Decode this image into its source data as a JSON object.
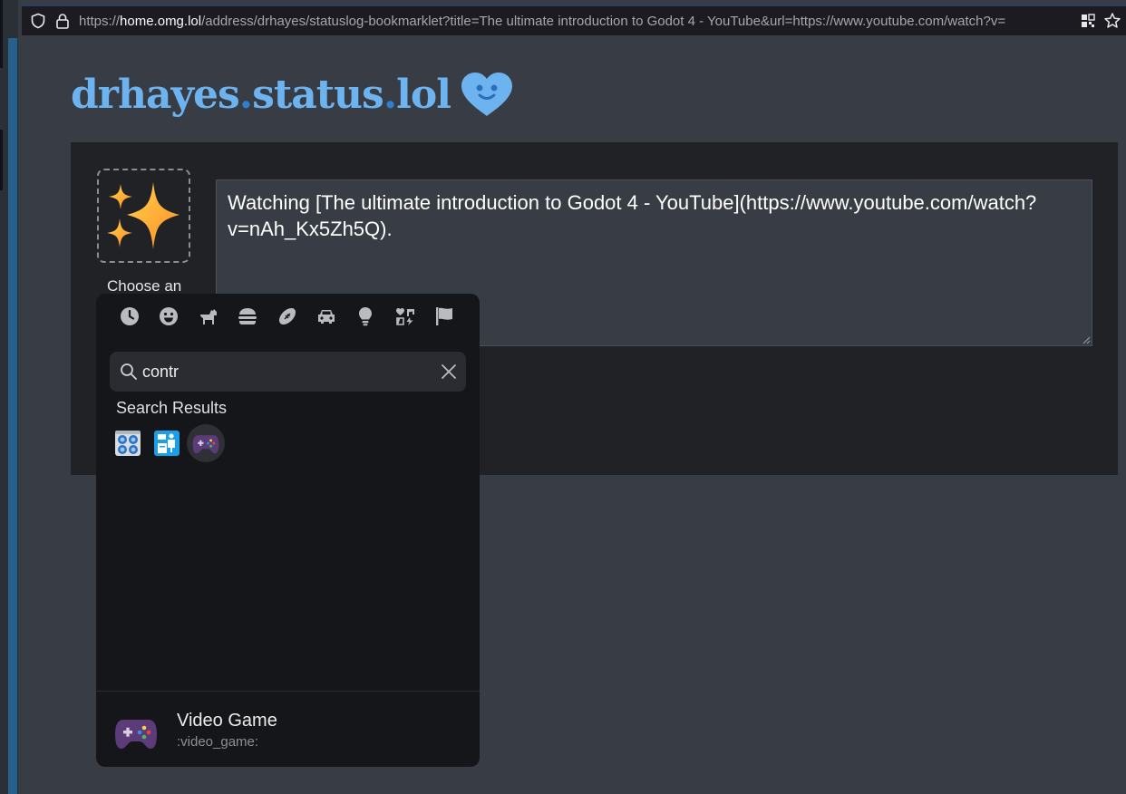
{
  "browser": {
    "url_prefix": "https://",
    "url_host": "home.omg.lol",
    "url_path": "/address/drhayes/statuslog-bookmarklet?title=The ultimate introduction to Godot 4 - YouTube&url=https://www.youtube.com/watch?v="
  },
  "logo": {
    "part1": "drhayes",
    "dot1": ".",
    "part2": "status",
    "dot2": ".",
    "part3": "lol"
  },
  "composer": {
    "status_text": "Watching [The ultimate introduction to Godot 4 - YouTube](https://www.youtube.com/watch?v=nAh_Kx5Zh5Q).",
    "choose_label": "Choose an",
    "selected_emoji_icon": "sparkles-icon"
  },
  "emoji_picker": {
    "categories": [
      {
        "name": "recent",
        "icon": "clock-icon"
      },
      {
        "name": "smileys",
        "icon": "smiley-icon"
      },
      {
        "name": "animals",
        "icon": "dog-icon"
      },
      {
        "name": "food",
        "icon": "burger-icon"
      },
      {
        "name": "activities",
        "icon": "football-icon"
      },
      {
        "name": "travel",
        "icon": "car-icon"
      },
      {
        "name": "objects",
        "icon": "lightbulb-icon"
      },
      {
        "name": "symbols",
        "icon": "symbols-icon"
      },
      {
        "name": "flags",
        "icon": "flag-icon"
      }
    ],
    "search_value": "contr",
    "results_title": "Search Results",
    "results": [
      {
        "icon": "control-knobs-icon"
      },
      {
        "icon": "passport-control-icon"
      },
      {
        "icon": "video-game-icon",
        "selected": true
      }
    ],
    "preview": {
      "icon": "video-game-icon",
      "name": "Video Game",
      "shortcode": ":video_game:"
    }
  },
  "colors": {
    "page_bg": "#383c44",
    "panel_bg": "#202226",
    "picker_bg": "#151619",
    "logo_blue": "#6cb3f0",
    "logo_dot_blue": "#2f7fd0"
  }
}
